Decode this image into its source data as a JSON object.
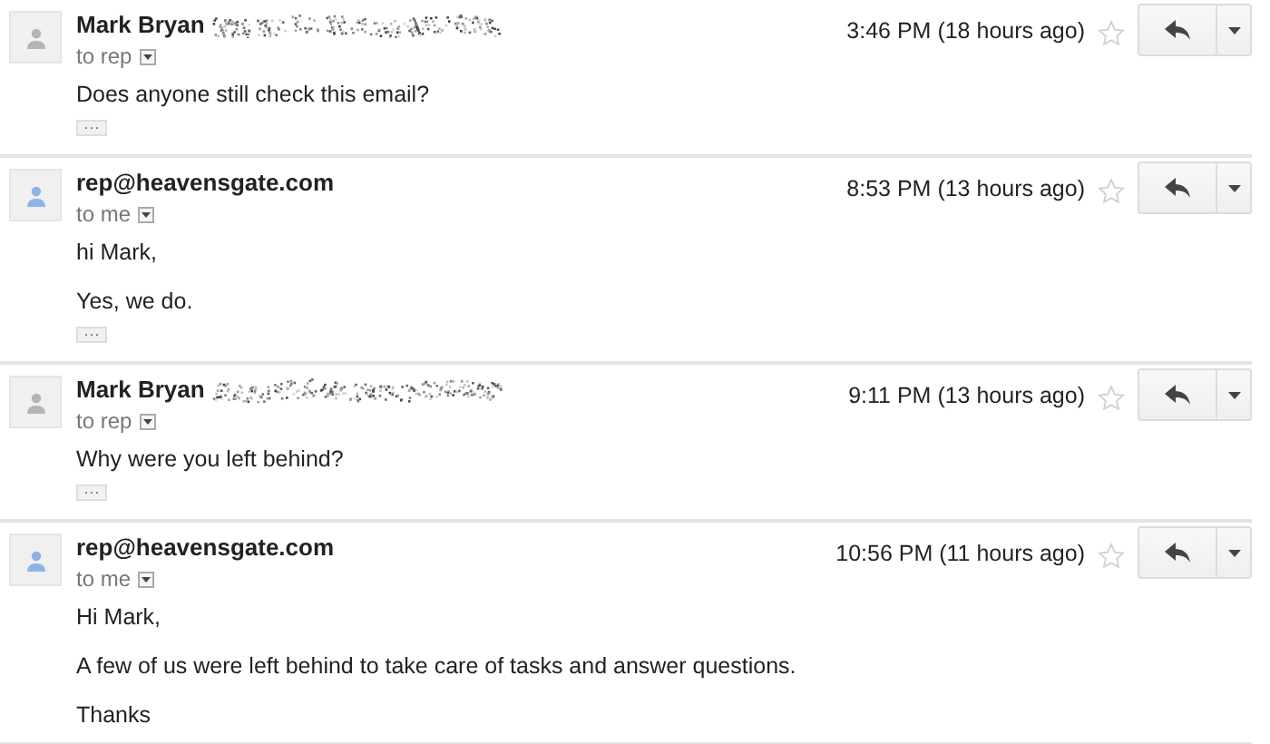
{
  "messages": [
    {
      "sender": "Mark Bryan",
      "redacted": true,
      "color": "#b4b4b4",
      "recipient": "to rep",
      "time": "3:46 PM (18 hours ago)",
      "starred": false,
      "paragraphs": [
        "Does anyone still check this email?"
      ],
      "trimmed": "···"
    },
    {
      "sender": "rep@heavensgate.com",
      "redacted": false,
      "color": "#8fb3e8",
      "recipient": "to me",
      "time": "8:53 PM (13 hours ago)",
      "starred": false,
      "paragraphs": [
        "hi Mark,",
        "Yes, we do."
      ],
      "trimmed": "···"
    },
    {
      "sender": "Mark Bryan",
      "redacted": true,
      "color": "#b4b4b4",
      "recipient": "to rep",
      "time": "9:11 PM (13 hours ago)",
      "starred": false,
      "paragraphs": [
        "Why were you left behind?"
      ],
      "trimmed": "···"
    },
    {
      "sender": "rep@heavensgate.com",
      "redacted": false,
      "color": "#8fb3e8",
      "recipient": "to me",
      "time": "10:56 PM (11 hours ago)",
      "starred": false,
      "paragraphs": [
        "Hi Mark,",
        "A few of us were left behind to take care of tasks and answer questions.",
        "Thanks"
      ]
    }
  ]
}
